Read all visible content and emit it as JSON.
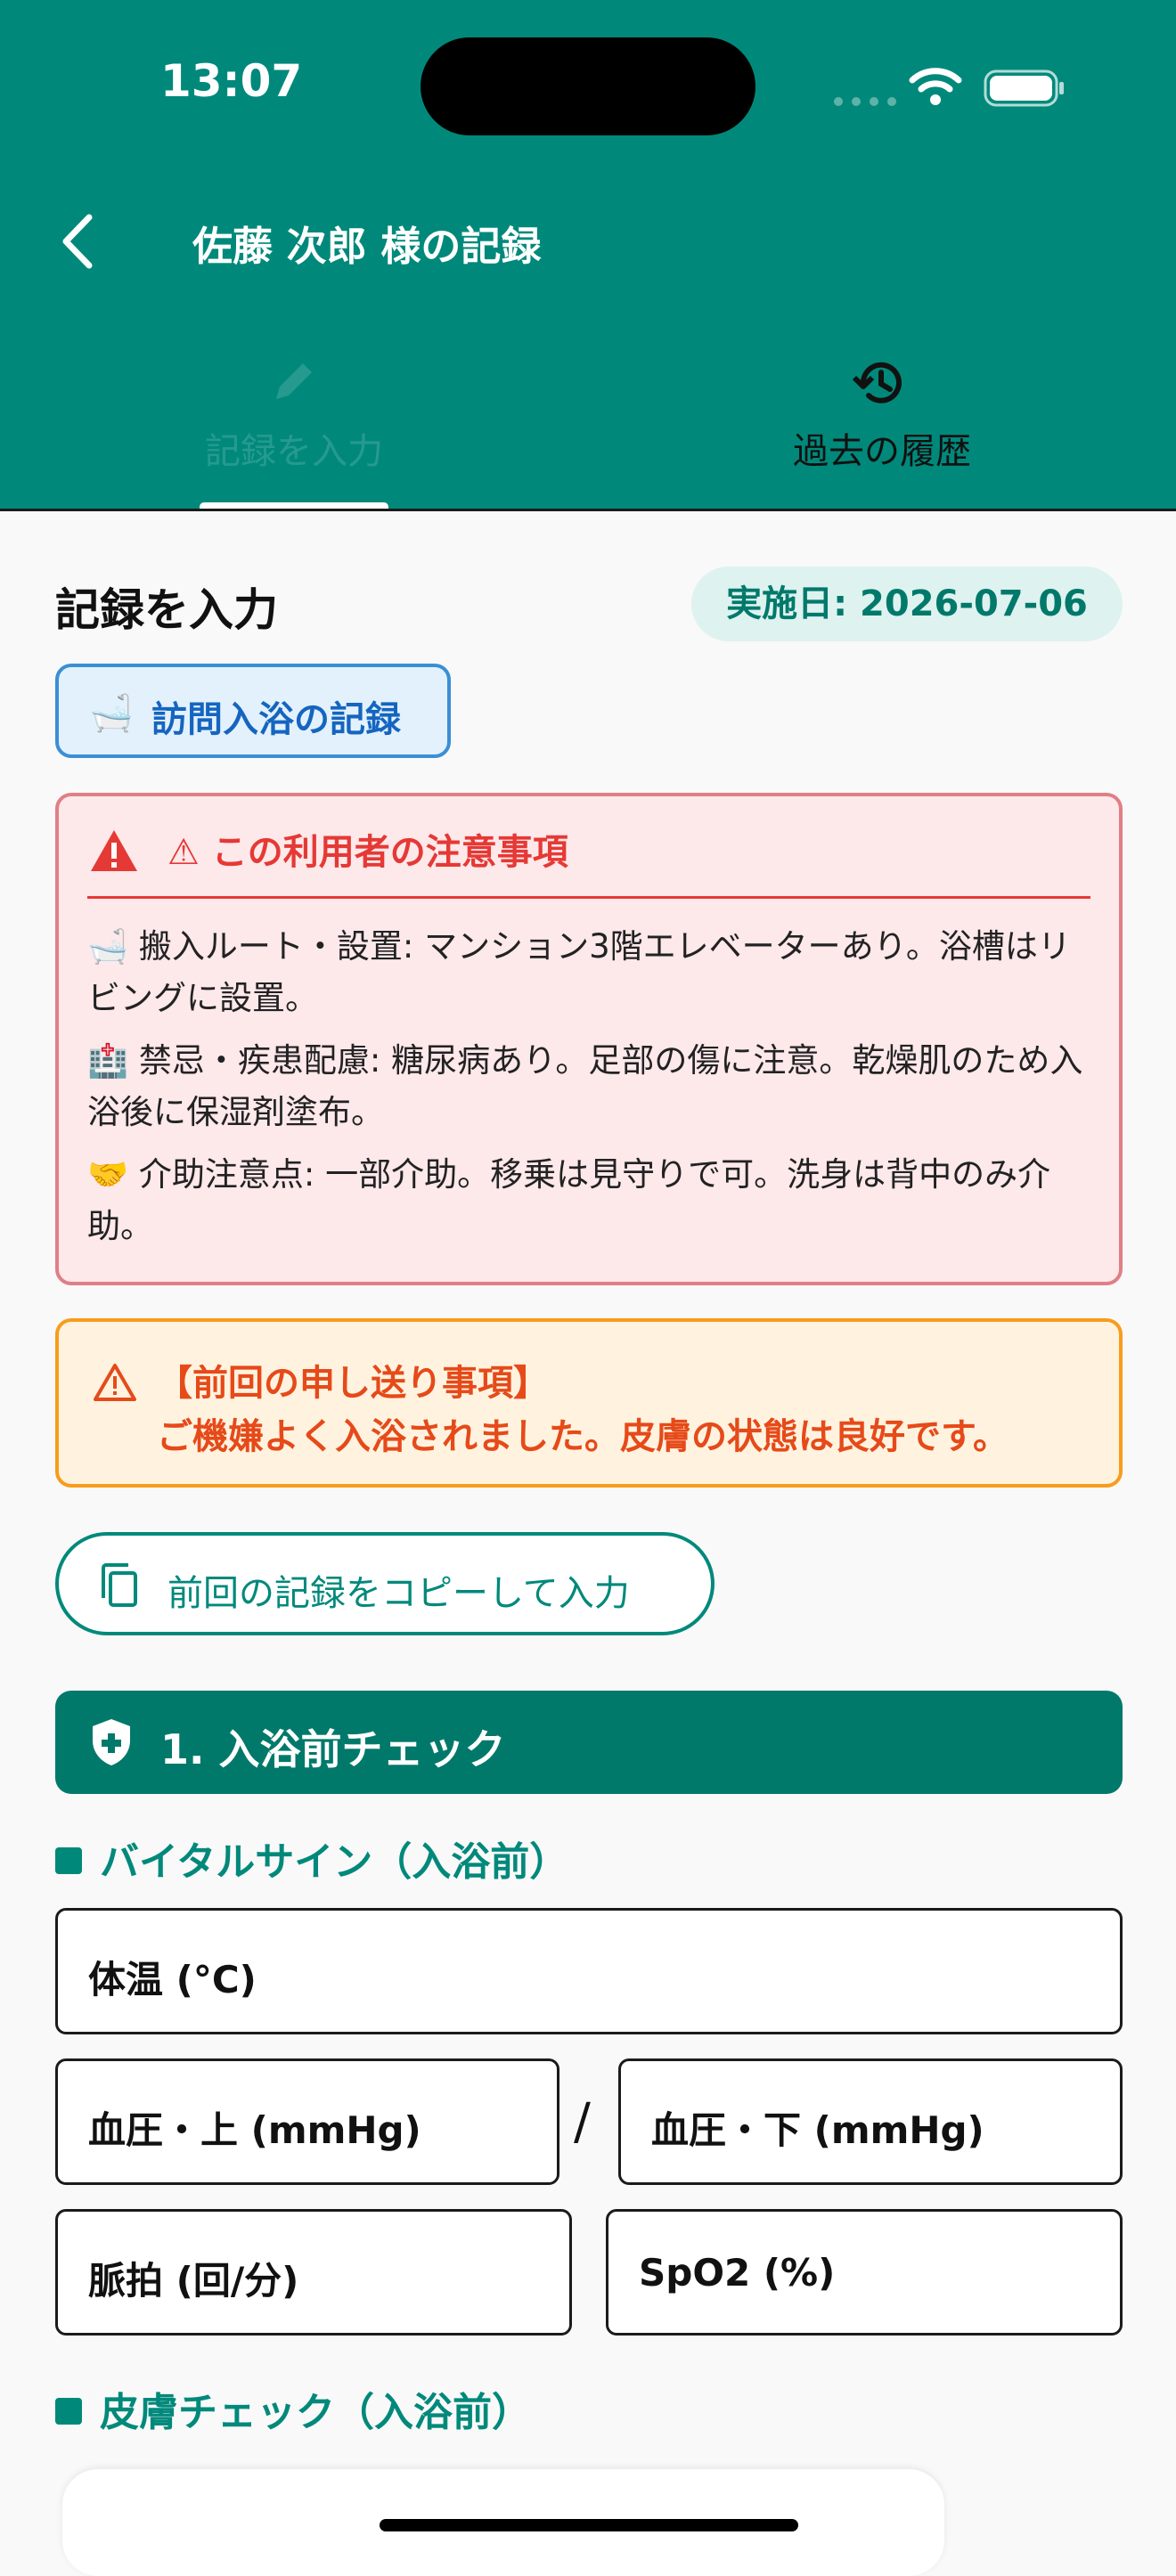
{
  "status_bar": {
    "time": "13:07"
  },
  "header": {
    "title": "佐藤 次郎 様の記録"
  },
  "tabs": [
    {
      "label": "記録を入力",
      "icon": "edit-icon",
      "active": true
    },
    {
      "label": "過去の履歴",
      "icon": "history-icon",
      "active": false
    }
  ],
  "form": {
    "heading": "記録を入力",
    "date_badge": "実施日: 2026-07-06",
    "service_tag": {
      "emoji": "🛁",
      "label": "訪問入浴の記録"
    }
  },
  "caution": {
    "title": "⚠ この利用者の注意事項",
    "items": [
      {
        "emoji": "🛁",
        "text": "搬入ルート・設置: マンション3階エレベーターあり。浴槽はリビングに設置。"
      },
      {
        "emoji": "🏥",
        "text": "禁忌・疾患配慮: 糖尿病あり。足部の傷に注意。乾燥肌のため入浴後に保湿剤塗布。"
      },
      {
        "emoji": "🤝",
        "text": "介助注意点: 一部介助。移乗は見守りで可。洗身は背中のみ介助。"
      }
    ]
  },
  "handover": {
    "title": "【前回の申し送り事項】",
    "text": "ご機嫌よく入浴されました。皮膚の状態は良好です。"
  },
  "copy_button": {
    "label": "前回の記録をコピーして入力"
  },
  "section1": {
    "title": "1. 入浴前チェック",
    "vitals_heading": "バイタルサイン（入浴前）",
    "fields": {
      "temp": "体温 (°C)",
      "bp_upper": "血圧・上 (mmHg)",
      "bp_sep": "/",
      "bp_lower": "血圧・下 (mmHg)",
      "pulse": "脈拍 (回/分)",
      "spo2": "SpO2 (%)"
    },
    "skin_heading": "皮膚チェック（入浴前）"
  },
  "colors": {
    "primary": "#00897b",
    "primary_dark": "#00796b",
    "danger": "#e53935",
    "warning": "#f89c1c",
    "info": "#1565c0"
  }
}
